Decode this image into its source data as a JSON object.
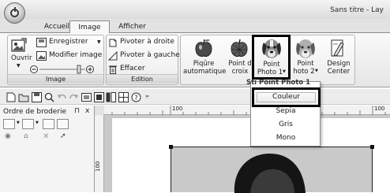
{
  "window": {
    "title": "Sans titre - Lay"
  },
  "tabs": {
    "accueil": "Accueil",
    "image": "Image",
    "afficher": "Afficher"
  },
  "group_image": {
    "label": "Image",
    "ouvrir": "Ouvrir",
    "enregistrer": "Enregistrer",
    "modifier": "Modifier image"
  },
  "group_edition": {
    "label": "Edition",
    "pivoter_droite": "Pivoter à droite",
    "pivoter_gauche": "Pivoter à gauche",
    "effacer": "Effacer"
  },
  "group_photo": {
    "piqure_line1": "Piqûre",
    "piqure_line2": "automatique",
    "point_croix_line1": "Point d",
    "point_croix_line2": "croix",
    "photo1_line1": "Point",
    "photo1_line2": "Photo 1",
    "photo2_line1": "Point",
    "photo2_line2": "hoto 2",
    "design_line1": "Design",
    "design_line2": "Center",
    "label": "Sti Point Photo 1"
  },
  "side_panel": {
    "title": "Ordre de broderie",
    "pin": "⊓",
    "close": "x"
  },
  "ruler": {
    "h_100_a": "100",
    "h_100_b": "100",
    "v_100": "100"
  },
  "dropdown": {
    "header": "Sti Point Photo 1",
    "selected": "Couleur",
    "items": [
      "Sepia",
      "Gris",
      "Mono"
    ]
  },
  "colors": {
    "ribbon_border": "#8a8a8a",
    "highlight": "#000000",
    "canvas_bg": "#c9c9c9"
  }
}
